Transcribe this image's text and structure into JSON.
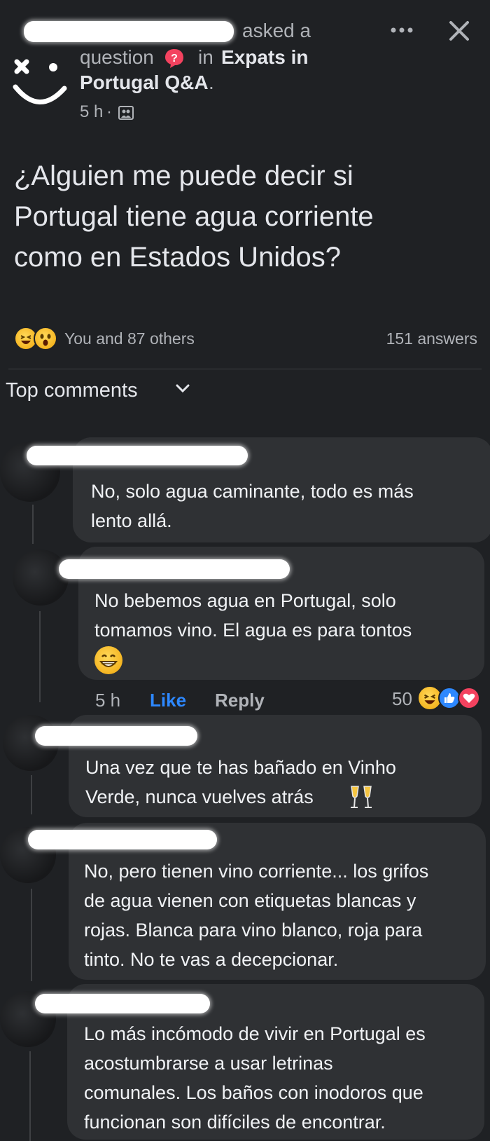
{
  "post": {
    "asked_a": "asked a",
    "question": "question",
    "in_word": "in",
    "group_line1": "Expats in",
    "group_line2": "Portugal Q&A",
    "group_period": ".",
    "time": "5 h",
    "time_sep": "·",
    "question_line1": "¿Alguien me puede decir si",
    "question_line2": "Portugal tiene agua corriente",
    "question_line3": "como en Estados Unidos?",
    "reactors": "You and 87 others",
    "answers": "151 answers"
  },
  "comments_header": {
    "label": "Top comments"
  },
  "comments": [
    {
      "lines": [
        "No, solo agua caminante, todo es más",
        "lento allá."
      ]
    },
    {
      "lines": [
        "No bebemos agua en Portugal, solo",
        "tomamos vino. El agua es para tontos"
      ],
      "time": "5 h",
      "like": "Like",
      "reply": "Reply",
      "reaction_count": "50"
    },
    {
      "lines": [
        "Una vez que te has bañado en Vinho",
        "Verde, nunca vuelves atrás"
      ]
    },
    {
      "lines": [
        "No, pero tienen vino corriente... los grifos",
        "de agua vienen con etiquetas blancas y",
        "rojas. Blanca para vino blanco, roja para",
        "tinto. No te vas a decepcionar."
      ]
    },
    {
      "lines": [
        "Lo más incómodo de vivir en Portugal es",
        "acostumbrarse a usar letrinas",
        "comunales. Los baños con inodoros que",
        "funcionan son difíciles de encontrar."
      ]
    }
  ],
  "icons": {
    "more": "more-options-icon",
    "close": "close-icon",
    "question_badge": "question-badge-icon",
    "audience": "group-audience-icon",
    "chevron": "chevron-down-icon"
  },
  "colors": {
    "background": "#1f2124",
    "bubble": "#2f3134",
    "like_blue": "#2d88ff",
    "badge_pink": "#f3425f"
  }
}
